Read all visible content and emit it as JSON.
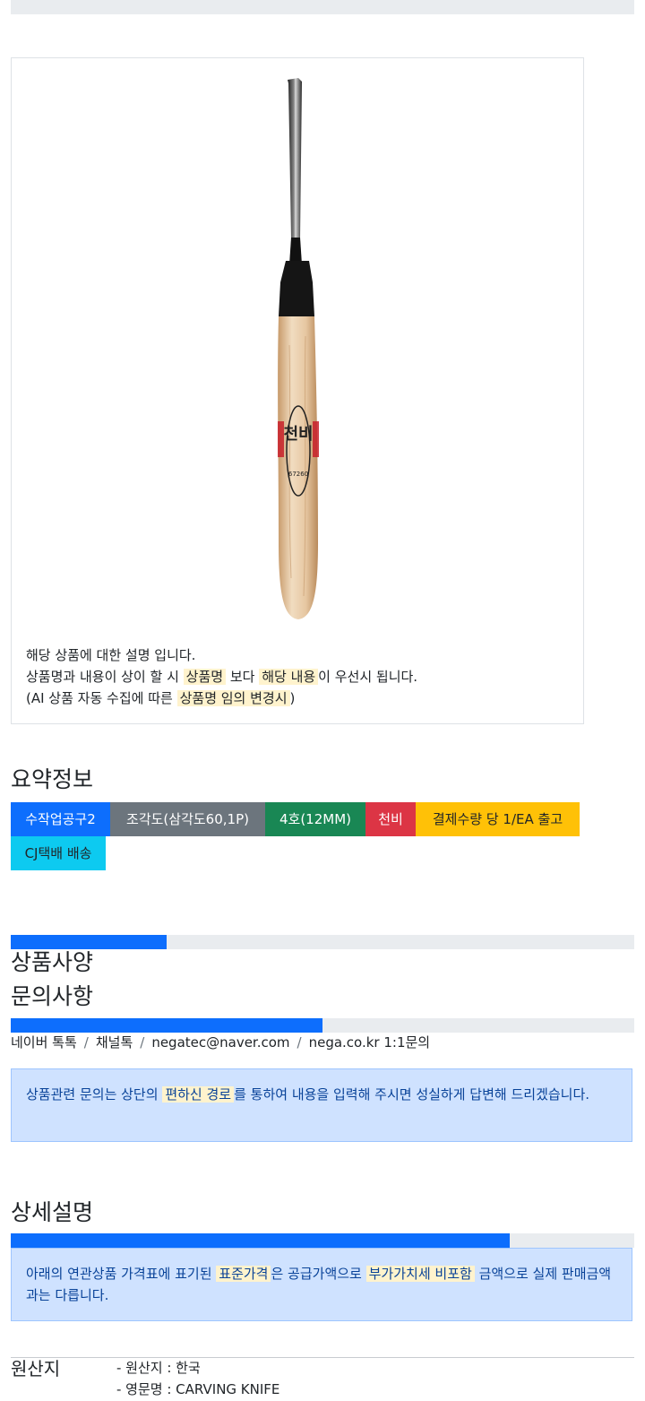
{
  "product": {
    "brand_mark": "천비",
    "code_mark": "67260",
    "side_mark_left": "山賀造",
    "side_mark_right": "特殊鋼"
  },
  "notice": {
    "line1": "해당 상품에 대한 설명 입니다.",
    "line2_a": "상품명과 내용이 상이 할 시 ",
    "line2_hl1": "상품명",
    "line2_b": " 보다 ",
    "line2_hl2": "해당 내용",
    "line2_c": "이 우선시 됩니다.",
    "line3_a": "(AI 상품 자동 수집에 따른 ",
    "line3_hl": "상품명 임의 변경시",
    "line3_b": ")"
  },
  "summary": {
    "title": "요약정보",
    "badges": [
      {
        "label": "수작업공구2",
        "color": "#0d6efd"
      },
      {
        "label": "조각도(삼각도60,1P)",
        "color": "#6c757d"
      },
      {
        "label": "4호(12MM)",
        "color": "#198754"
      },
      {
        "label": "천비",
        "color": "#dc3545"
      },
      {
        "label": "결제수량 당 1/EA 출고",
        "color": "#ffc107"
      },
      {
        "label": "CJ택배 배송",
        "color": "#0dcaf0"
      }
    ]
  },
  "spec": {
    "title": "상품사양",
    "progress": 0.25
  },
  "inquiry": {
    "title": "문의사항",
    "progress": 0.5,
    "channels": [
      "네이버 톡톡",
      "채널톡",
      "negatec@naver.com",
      "nega.co.kr 1:1문의"
    ],
    "sep": "/",
    "alert_a": "상품관련 문의는 상단의 ",
    "alert_hl": "편하신 경로",
    "alert_b": "를 통하여 내용을 입력해 주시면 성실하게 답변해 드리겠습니다."
  },
  "detail": {
    "title": "상세설명",
    "progress": 0.8,
    "alert_a": "아래의 연관상품 가격표에 표기된 ",
    "alert_hl1": "표준가격",
    "alert_b": "은 공급가액으로 ",
    "alert_hl2": "부가가치세 비포함",
    "alert_c": " 금액으로 실제 판매금액과는 다릅니다."
  },
  "origin": {
    "title": "원산지",
    "items": [
      "- 원산지 : 한국",
      "- 영문명 : CARVING KNIFE"
    ]
  },
  "colors": {
    "primary": "#0d6efd",
    "highlight": "#fff3cd",
    "alert_bg": "#cfe2ff"
  }
}
